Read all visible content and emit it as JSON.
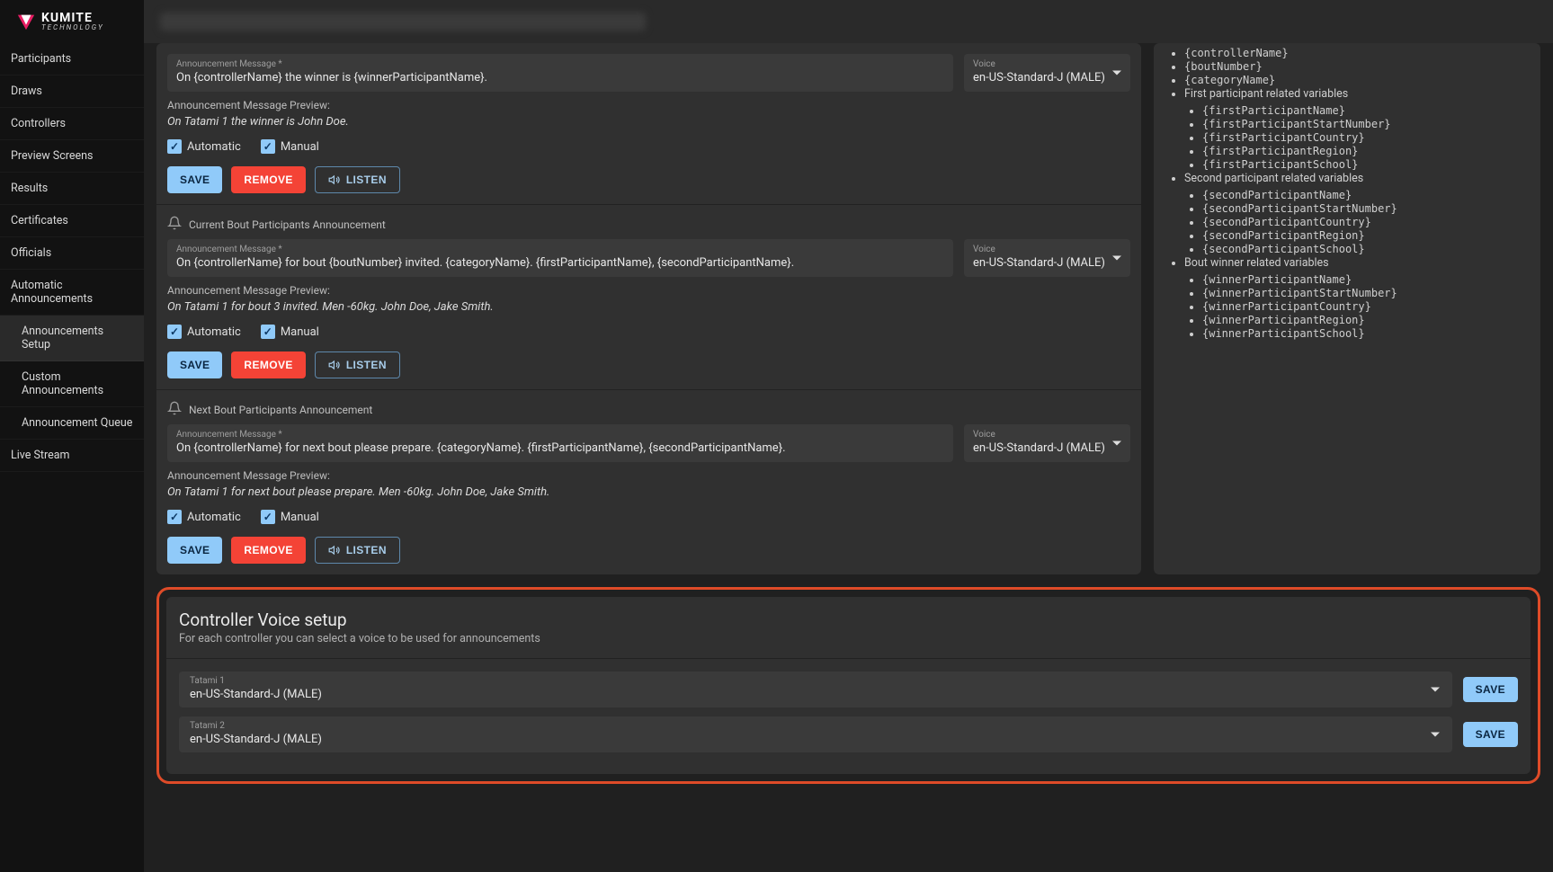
{
  "brand": {
    "name": "KUMITE",
    "sub": "TECHNOLOGY"
  },
  "sidebar": {
    "items": [
      {
        "label": "Participants"
      },
      {
        "label": "Draws"
      },
      {
        "label": "Controllers"
      },
      {
        "label": "Preview Screens"
      },
      {
        "label": "Results"
      },
      {
        "label": "Certificates"
      },
      {
        "label": "Officials"
      },
      {
        "label": "Automatic Announcements"
      },
      {
        "label": "Announcements Setup",
        "sub": true,
        "active": true
      },
      {
        "label": "Custom Announcements",
        "sub": true
      },
      {
        "label": "Announcement Queue",
        "sub": true
      },
      {
        "label": "Live Stream"
      }
    ]
  },
  "labels": {
    "announcement_message": "Announcement Message *",
    "voice": "Voice",
    "preview": "Announcement Message Preview:",
    "automatic": "Automatic",
    "manual": "Manual",
    "save": "SAVE",
    "remove": "REMOVE",
    "listen": "LISTEN"
  },
  "announcements": [
    {
      "title": "",
      "message": "On {controllerName} the winner is {winnerParticipantName}.",
      "voice": "en-US-Standard-J (MALE)",
      "preview": "On Tatami 1 the winner is John Doe.",
      "automatic": true,
      "manual": true
    },
    {
      "title": "Current Bout Participants Announcement",
      "message": "On {controllerName} for bout {boutNumber} invited. {categoryName}. {firstParticipantName}, {secondParticipantName}.",
      "voice": "en-US-Standard-J (MALE)",
      "preview": "On Tatami 1 for bout 3 invited. Men -60kg. John Doe, Jake Smith.",
      "automatic": true,
      "manual": true
    },
    {
      "title": "Next Bout Participants Announcement",
      "message": "On {controllerName} for next bout please prepare. {categoryName}. {firstParticipantName}, {secondParticipantName}.",
      "voice": "en-US-Standard-J (MALE)",
      "preview": "On Tatami 1 for next bout please prepare. Men -60kg. John Doe, Jake Smith.",
      "automatic": true,
      "manual": true
    }
  ],
  "variable_help": {
    "groups": [
      {
        "title": "",
        "vars": [
          "{controllerName}",
          "{boutNumber}",
          "{categoryName}"
        ]
      },
      {
        "title": "First participant related variables",
        "vars": [
          "{firstParticipantName}",
          "{firstParticipantStartNumber}",
          "{firstParticipantCountry}",
          "{firstParticipantRegion}",
          "{firstParticipantSchool}"
        ]
      },
      {
        "title": "Second participant related variables",
        "vars": [
          "{secondParticipantName}",
          "{secondParticipantStartNumber}",
          "{secondParticipantCountry}",
          "{secondParticipantRegion}",
          "{secondParticipantSchool}"
        ]
      },
      {
        "title": "Bout winner related variables",
        "vars": [
          "{winnerParticipantName}",
          "{winnerParticipantStartNumber}",
          "{winnerParticipantCountry}",
          "{winnerParticipantRegion}",
          "{winnerParticipantSchool}"
        ]
      }
    ]
  },
  "controller_voice": {
    "title": "Controller Voice setup",
    "subtitle": "For each controller you can select a voice to be used for announcements",
    "rows": [
      {
        "label": "Tatami 1",
        "value": "en-US-Standard-J (MALE)"
      },
      {
        "label": "Tatami 2",
        "value": "en-US-Standard-J (MALE)"
      }
    ]
  }
}
